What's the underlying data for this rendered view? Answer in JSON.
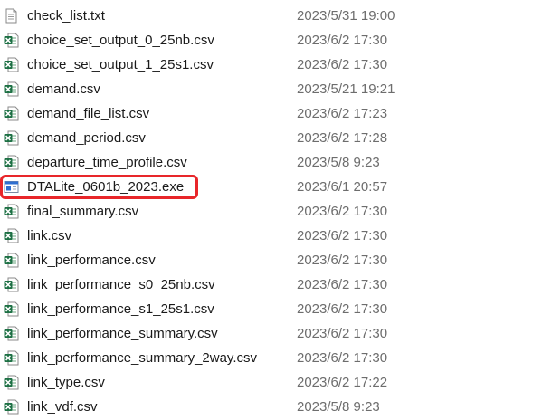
{
  "accent": {
    "excel_green": "#1d7044",
    "highlight_red": "#e8262a",
    "date_gray": "#6d6d6d"
  },
  "files": [
    {
      "name": "check_list.txt",
      "date": "2023/5/31 19:00",
      "icon": "text-file-icon"
    },
    {
      "name": "choice_set_output_0_25nb.csv",
      "date": "2023/6/2 17:30",
      "icon": "excel-csv-icon"
    },
    {
      "name": "choice_set_output_1_25s1.csv",
      "date": "2023/6/2 17:30",
      "icon": "excel-csv-icon"
    },
    {
      "name": "demand.csv",
      "date": "2023/5/21 19:21",
      "icon": "excel-csv-icon"
    },
    {
      "name": "demand_file_list.csv",
      "date": "2023/6/2 17:23",
      "icon": "excel-csv-icon"
    },
    {
      "name": "demand_period.csv",
      "date": "2023/6/2 17:28",
      "icon": "excel-csv-icon"
    },
    {
      "name": "departure_time_profile.csv",
      "date": "2023/5/8 9:23",
      "icon": "excel-csv-icon"
    },
    {
      "name": "DTALite_0601b_2023.exe",
      "date": "2023/6/1 20:57",
      "icon": "exe-app-icon",
      "highlighted": true
    },
    {
      "name": "final_summary.csv",
      "date": "2023/6/2 17:30",
      "icon": "excel-csv-icon"
    },
    {
      "name": "link.csv",
      "date": "2023/6/2 17:30",
      "icon": "excel-csv-icon"
    },
    {
      "name": "link_performance.csv",
      "date": "2023/6/2 17:30",
      "icon": "excel-csv-icon"
    },
    {
      "name": "link_performance_s0_25nb.csv",
      "date": "2023/6/2 17:30",
      "icon": "excel-csv-icon"
    },
    {
      "name": "link_performance_s1_25s1.csv",
      "date": "2023/6/2 17:30",
      "icon": "excel-csv-icon"
    },
    {
      "name": "link_performance_summary.csv",
      "date": "2023/6/2 17:30",
      "icon": "excel-csv-icon"
    },
    {
      "name": "link_performance_summary_2way.csv",
      "date": "2023/6/2 17:30",
      "icon": "excel-csv-icon"
    },
    {
      "name": "link_type.csv",
      "date": "2023/6/2 17:22",
      "icon": "excel-csv-icon"
    },
    {
      "name": "link_vdf.csv",
      "date": "2023/5/8 9:23",
      "icon": "excel-csv-icon"
    }
  ]
}
